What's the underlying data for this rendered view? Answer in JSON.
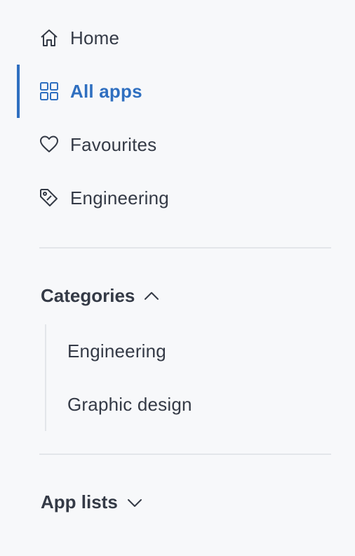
{
  "nav": {
    "items": [
      {
        "label": "Home",
        "icon": "home-icon"
      },
      {
        "label": "All apps",
        "icon": "grid-icon",
        "active": true
      },
      {
        "label": "Favourites",
        "icon": "heart-icon"
      },
      {
        "label": "Engineering",
        "icon": "tag-icon"
      }
    ]
  },
  "categories": {
    "title": "Categories",
    "expanded": true,
    "items": [
      "Engineering",
      "Graphic design"
    ]
  },
  "app_lists": {
    "title": "App lists",
    "expanded": false
  },
  "colors": {
    "accent": "#2f6fc0",
    "text": "#343a46",
    "background": "#f7f8fa",
    "divider": "#e3e6ea"
  }
}
